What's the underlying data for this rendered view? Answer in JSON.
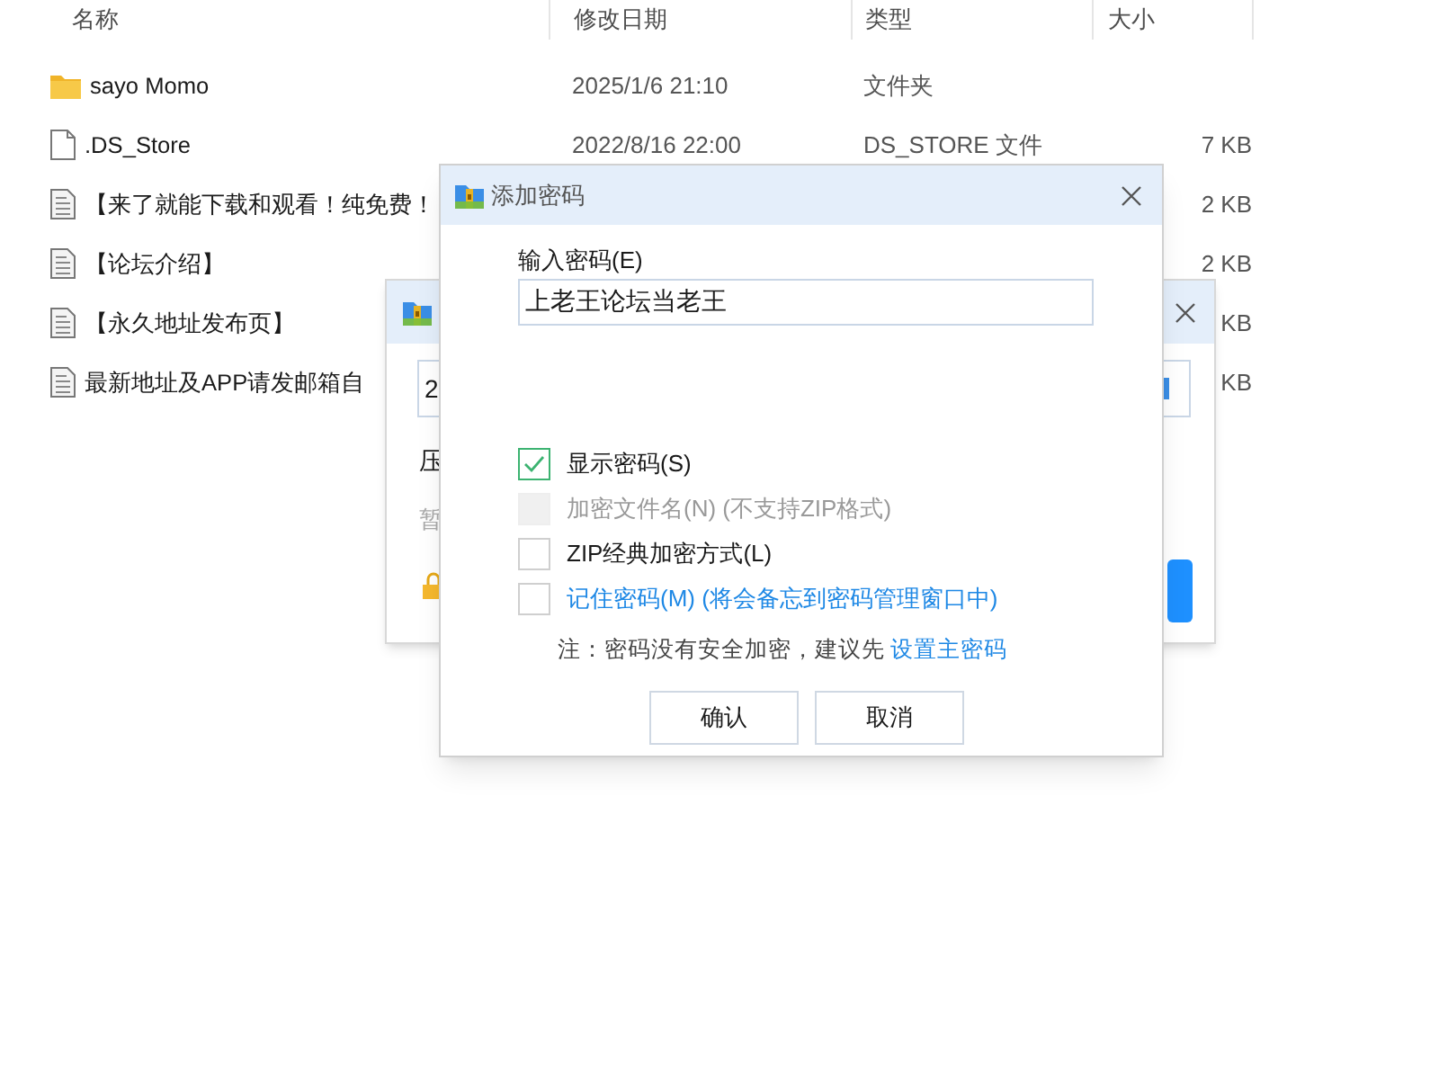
{
  "file_list": {
    "columns": [
      "名称",
      "修改日期",
      "类型",
      "大小"
    ],
    "rows": [
      {
        "kind": "folder",
        "name": "sayo Momo",
        "modified": "2025/1/6 21:10",
        "type": "文件夹"
      },
      {
        "kind": "blank",
        "name": ".DS_Store",
        "modified": "2022/8/16 22:00",
        "type": "DS_STORE 文件",
        "size": "7 KB"
      },
      {
        "kind": "text",
        "name": "【来了就能下载和观看！纯免费！",
        "size": "2 KB"
      },
      {
        "kind": "text",
        "name": "【论坛介绍】",
        "size": "2 KB"
      },
      {
        "kind": "text",
        "name": "【永久地址发布页】",
        "size": "KB"
      },
      {
        "kind": "text",
        "name": "最新地址及APP请发邮箱自",
        "size": "KB"
      }
    ]
  },
  "back_dialog": {
    "field_value": "2",
    "label": "压",
    "hint": "暂"
  },
  "dialog": {
    "title": "添加密码",
    "password_label": "输入密码(E)",
    "password_value": "上老王论坛当老王",
    "options": [
      {
        "kind": "plain",
        "label": "显示密码(S)",
        "checked": true,
        "disabled": false
      },
      {
        "kind": "plain",
        "label": "加密文件名(N) (不支持ZIP格式)",
        "checked": false,
        "disabled": true
      },
      {
        "kind": "plain",
        "label": "ZIP经典加密方式(L)",
        "checked": false,
        "disabled": false
      },
      {
        "kind": "link",
        "label": "记住密码(M) (将会备忘到密码管理窗口中)",
        "checked": false,
        "disabled": false
      }
    ],
    "note": "注：密码没有安全加密，建议先",
    "note_link": "设置主密码",
    "buttons": [
      "确认",
      "取消"
    ]
  }
}
